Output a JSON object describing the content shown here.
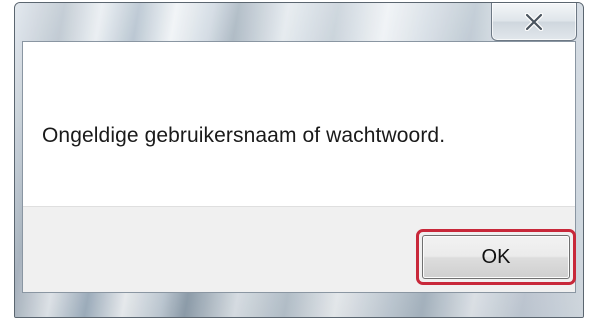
{
  "dialog": {
    "message": "Ongeldige gebruikersnaam of wachtwoord.",
    "ok_label": "OK",
    "close_icon": "close-x-icon",
    "highlight_color": "#c8283a"
  }
}
